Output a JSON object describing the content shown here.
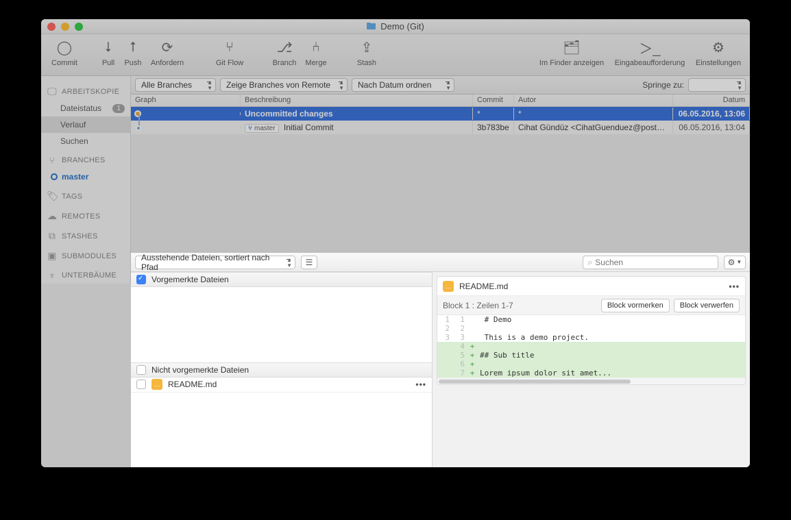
{
  "window": {
    "title": "Demo (Git)"
  },
  "toolbar": {
    "commit": "Commit",
    "pull": "Pull",
    "push": "Push",
    "request": "Anfordern",
    "gitflow": "Git Flow",
    "branch": "Branch",
    "merge": "Merge",
    "stash": "Stash",
    "finder": "Im Finder anzeigen",
    "terminal": "Eingabeaufforderung",
    "settings": "Einstellungen"
  },
  "sidebar": {
    "workingcopy": "ARBEITSKOPIE",
    "items": {
      "filestatus": "Dateistatus",
      "history": "Verlauf",
      "search": "Suchen"
    },
    "filestatus_badge": "1",
    "branches": "BRANCHES",
    "master": "master",
    "tags": "TAGS",
    "remotes": "REMOTES",
    "stashes": "STASHES",
    "submodules": "SUBMODULES",
    "subtrees": "UNTERBÄUME"
  },
  "filters": {
    "all_branches": "Alle Branches",
    "show_remote": "Zeige Branches von Remote",
    "sort_date": "Nach Datum ordnen",
    "jump_label": "Springe zu:"
  },
  "commit_table": {
    "headers": {
      "graph": "Graph",
      "desc": "Beschreibung",
      "commit": "Commit",
      "author": "Autor",
      "date": "Datum"
    },
    "rows": [
      {
        "desc": "Uncommitted changes",
        "commit": "*",
        "author": "*",
        "date": "06.05.2016, 13:06"
      },
      {
        "branch_tag": "master",
        "desc": "Initial Commit",
        "commit": "3b783be",
        "author": "Cihat Gündüz <CihatGuenduez@posteo….",
        "date": "06.05.2016, 13:04"
      }
    ]
  },
  "stage": {
    "sort_dropdown": "Ausstehende Dateien, sortiert nach Pfad",
    "search_placeholder": "Suchen",
    "staged_header": "Vorgemerkte Dateien",
    "unstaged_header": "Nicht vorgemerkte Dateien",
    "file": "README.md"
  },
  "diff": {
    "filename": "README.md",
    "hunk_label": "Block 1 : Zeilen 1-7",
    "stage_hunk": "Block vormerken",
    "discard_hunk": "Block verwerfen",
    "lines": [
      {
        "lold": "1",
        "lnew": "1",
        "sign": "",
        "text": " # Demo",
        "add": false
      },
      {
        "lold": "2",
        "lnew": "2",
        "sign": "",
        "text": " ",
        "add": false
      },
      {
        "lold": "3",
        "lnew": "3",
        "sign": "",
        "text": " This is a demo project.",
        "add": false
      },
      {
        "lold": "",
        "lnew": "4",
        "sign": "+",
        "text": "",
        "add": true
      },
      {
        "lold": "",
        "lnew": "5",
        "sign": "+",
        "text": "## Sub title",
        "add": true
      },
      {
        "lold": "",
        "lnew": "6",
        "sign": "+",
        "text": "",
        "add": true
      },
      {
        "lold": "",
        "lnew": "7",
        "sign": "+",
        "text": "Lorem ipsum dolor sit amet...",
        "add": true
      }
    ]
  }
}
